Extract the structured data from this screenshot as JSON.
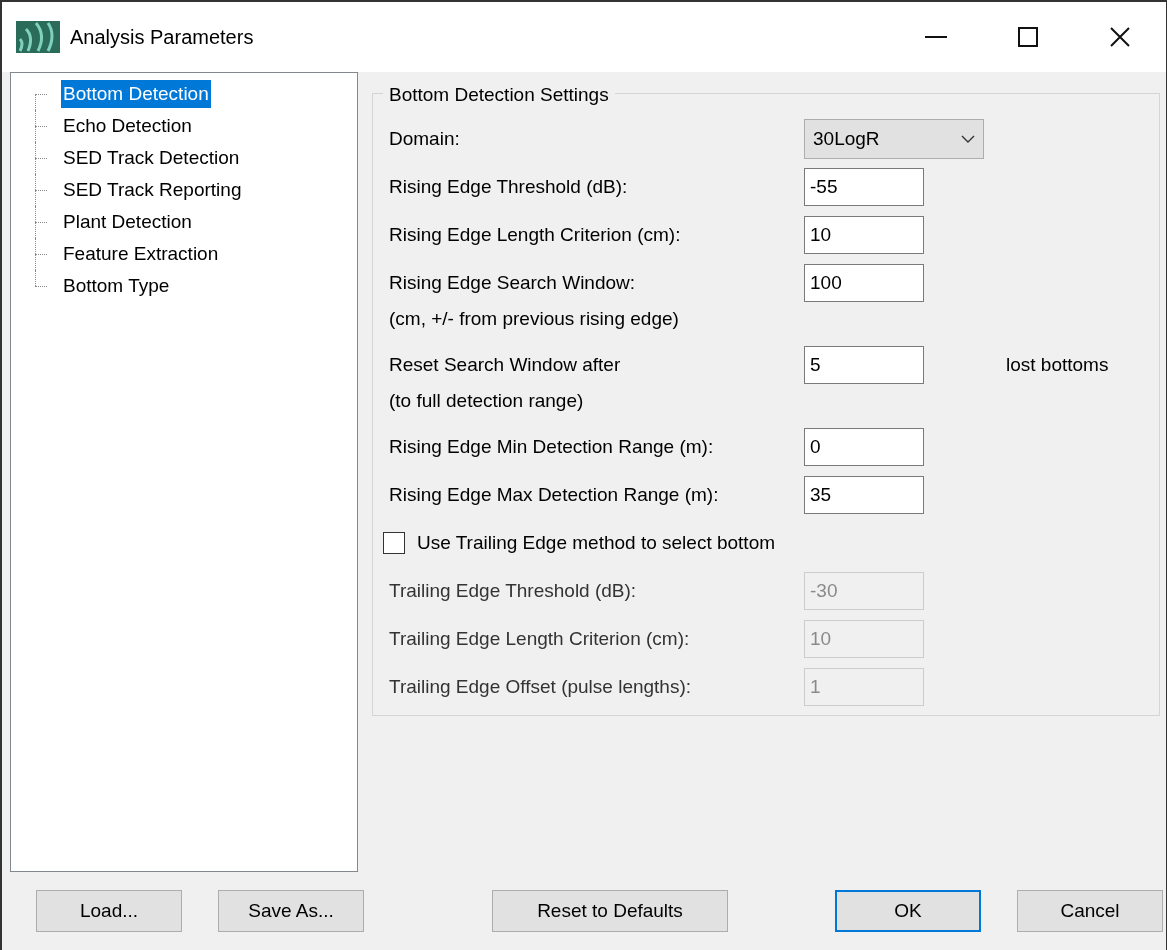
{
  "window": {
    "title": "Analysis Parameters"
  },
  "tree": {
    "items": [
      {
        "label": "Bottom Detection",
        "selected": true
      },
      {
        "label": "Echo Detection",
        "selected": false
      },
      {
        "label": "SED Track Detection",
        "selected": false
      },
      {
        "label": "SED Track Reporting",
        "selected": false
      },
      {
        "label": "Plant Detection",
        "selected": false
      },
      {
        "label": "Feature Extraction",
        "selected": false
      },
      {
        "label": "Bottom Type",
        "selected": false
      }
    ]
  },
  "group": {
    "title": "Bottom Detection Settings",
    "rows": [
      {
        "kind": "dropdown",
        "label": "Domain:",
        "value": "30LogR"
      },
      {
        "kind": "field",
        "label": "Rising Edge Threshold (dB):",
        "value": "-55",
        "disabled": false
      },
      {
        "kind": "field",
        "label": "Rising Edge Length Criterion (cm):",
        "value": "10",
        "disabled": false
      },
      {
        "kind": "field",
        "label": "Rising Edge Search Window:",
        "sublabel": "(cm, +/- from previous rising edge)",
        "value": "100",
        "disabled": false
      },
      {
        "kind": "field",
        "label": "Reset Search Window after",
        "sublabel": "(to full detection range)",
        "value": "5",
        "suffix": "lost bottoms",
        "disabled": false
      },
      {
        "kind": "field",
        "label": "Rising Edge Min Detection Range (m):",
        "value": "0",
        "disabled": false
      },
      {
        "kind": "field",
        "label": "Rising Edge Max Detection Range (m):",
        "value": "35",
        "disabled": false
      },
      {
        "kind": "checkbox",
        "label": "Use Trailing Edge method to select bottom",
        "checked": false
      },
      {
        "kind": "field",
        "label": "Trailing Edge Threshold (dB):",
        "value": "-30",
        "disabled": true
      },
      {
        "kind": "field",
        "label": "Trailing Edge Length Criterion (cm):",
        "value": "10",
        "disabled": true
      },
      {
        "kind": "field",
        "label": "Trailing Edge Offset (pulse lengths):",
        "value": "1",
        "disabled": true
      }
    ]
  },
  "buttons": [
    {
      "label": "Load...",
      "default": false
    },
    {
      "label": "Save As...",
      "default": false
    },
    {
      "label": "Reset to Defaults",
      "default": false
    },
    {
      "label": "OK",
      "default": true
    },
    {
      "label": "Cancel",
      "default": false
    }
  ]
}
